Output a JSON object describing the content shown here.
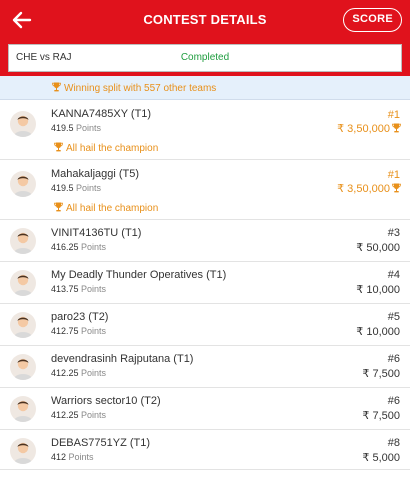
{
  "header": {
    "title": "CONTEST DETAILS",
    "score_label": "SCORE",
    "back_icon": "arrow-left-icon",
    "bg_color": "#e0121c"
  },
  "match": {
    "name": "CHE vs RAJ",
    "status": "Completed",
    "status_color": "#1f9d3f"
  },
  "banner": {
    "icon": "trophy-icon",
    "text": "Winning split with 557 other teams",
    "color": "#e8901a"
  },
  "rows": [
    {
      "name": "KANNA7485XY (T1)",
      "points": "419.5",
      "points_unit": "Points",
      "rank": "#1",
      "prize": "₹ 3,50,000",
      "champion": "All hail the champion"
    },
    {
      "name": "Mahakaljaggi (T5)",
      "points": "419.5",
      "points_unit": "Points",
      "rank": "#1",
      "prize": "₹ 3,50,000",
      "champion": "All hail the champion"
    },
    {
      "name": "VINIT4136TU (T1)",
      "points": "416.25",
      "points_unit": "Points",
      "rank": "#3",
      "prize": "₹ 50,000"
    },
    {
      "name": "My Deadly Thunder Operatives (T1)",
      "points": "413.75",
      "points_unit": "Points",
      "rank": "#4",
      "prize": "₹ 10,000"
    },
    {
      "name": "paro23 (T2)",
      "points": "412.75",
      "points_unit": "Points",
      "rank": "#5",
      "prize": "₹ 10,000"
    },
    {
      "name": "devendrasinh Rajputana (T1)",
      "points": "412.25",
      "points_unit": "Points",
      "rank": "#6",
      "prize": "₹ 7,500"
    },
    {
      "name": "Warriors sector10 (T2)",
      "points": "412.25",
      "points_unit": "Points",
      "rank": "#6",
      "prize": "₹ 7,500"
    },
    {
      "name": "DEBAS7751YZ (T1)",
      "points": "412",
      "points_unit": "Points",
      "rank": "#8",
      "prize": "₹ 5,000"
    }
  ]
}
